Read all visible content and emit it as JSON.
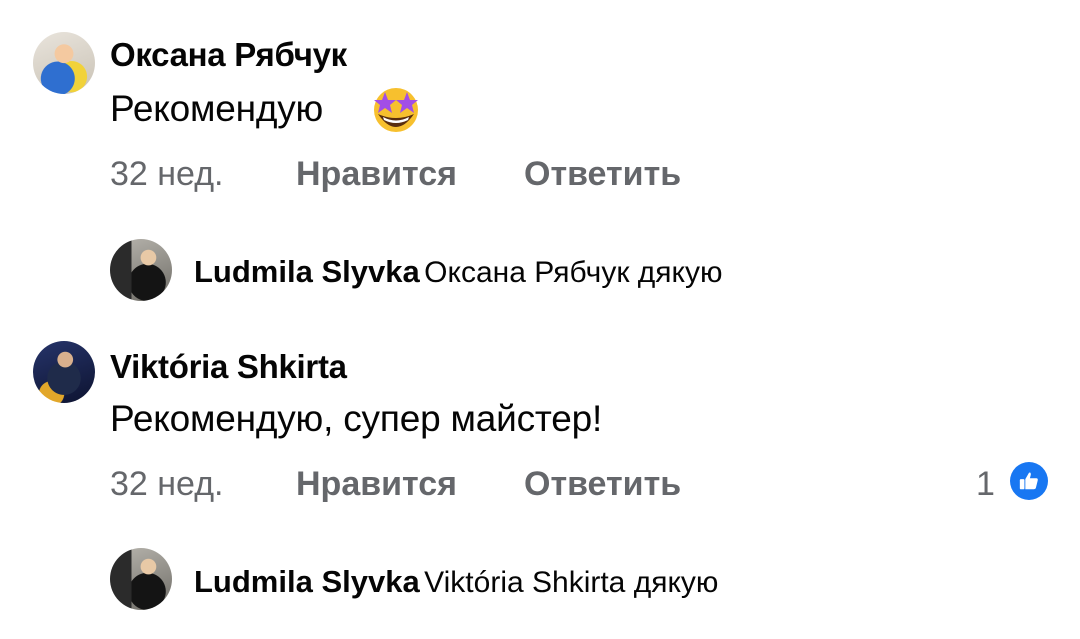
{
  "comments": [
    {
      "author": "Оксана Рябчук",
      "text": "Рекомендую",
      "emoji": "star-struck-emoji",
      "time": "32 нед.",
      "like_label": "Нравится",
      "reply_label": "Ответить",
      "reply": {
        "author": "Ludmila Slyvka",
        "text": "Оксана Рябчук дякую"
      }
    },
    {
      "author": "Viktória Shkirta",
      "text": "Рекомендую, супер майстер!",
      "time": "32 нед.",
      "like_label": "Нравится",
      "reply_label": "Ответить",
      "reaction_count": "1",
      "reaction_icon": "thumbs-up-icon",
      "reply": {
        "author": "Ludmila Slyvka",
        "text": "Viktória Shkirta дякую"
      }
    }
  ],
  "colors": {
    "text": "#050505",
    "secondary": "#65676b",
    "like_blue": "#1877f2"
  }
}
